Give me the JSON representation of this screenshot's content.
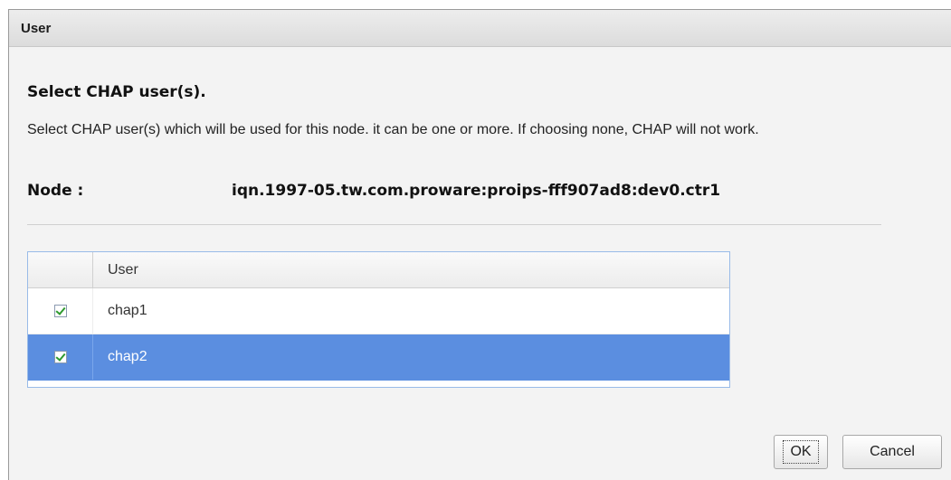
{
  "dialog": {
    "title": "User",
    "heading": "Select CHAP user(s).",
    "description": "Select CHAP user(s) which will be used for this node. it can be one or more. If choosing none, CHAP will not work.",
    "node_label": "Node :",
    "node_value": "iqn.1997-05.tw.com.proware:proips-fff907ad8:dev0.ctr1"
  },
  "table": {
    "columns": [
      "",
      "User"
    ],
    "rows": [
      {
        "checked": true,
        "user": "chap1",
        "selected": false
      },
      {
        "checked": true,
        "user": "chap2",
        "selected": true
      }
    ]
  },
  "buttons": {
    "ok_label": "OK",
    "cancel_label": "Cancel"
  },
  "colors": {
    "selected_row": "#5b8ee0",
    "check": "#2e9a2e",
    "grid_border": "#99bbe8"
  }
}
